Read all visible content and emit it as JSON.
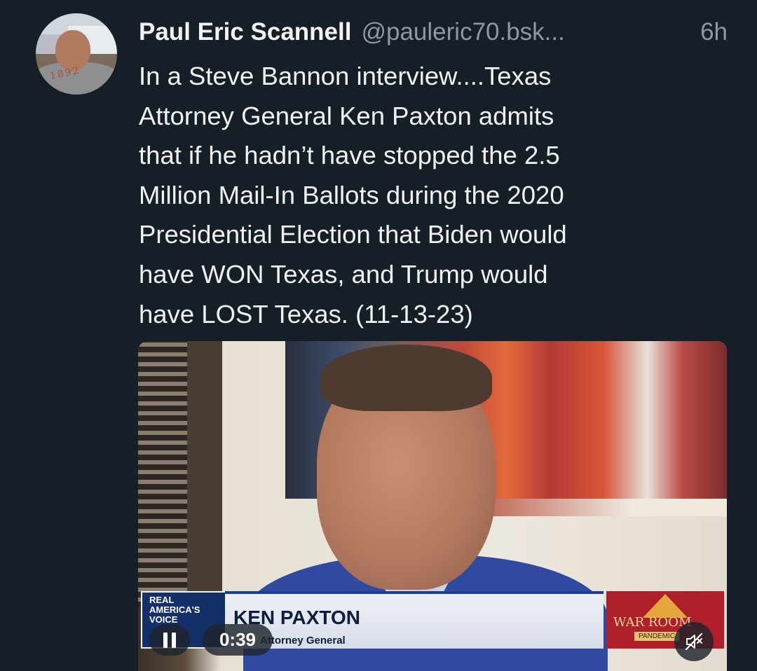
{
  "post": {
    "author_name": "Paul Eric Scannell",
    "author_handle": "@pauleric70.bsk...",
    "timestamp": "6h",
    "avatar_text": "1892",
    "body": "In a  Steve Bannon interview....Texas\nAttorney General Ken Paxton admits\nthat if he hadn’t  have stopped the 2.5\nMillion Mail-In Ballots during the 2020\nPresidential Election that Biden would\nhave WON Texas, and Trump  would\nhave LOST Texas. (11-13-23)"
  },
  "video": {
    "network_logo": "REAL AMERICA'S VOICE",
    "lower_third_name": "KEN PAXTON",
    "lower_third_title": "Attorney General",
    "show_logo": "WAR ROOM",
    "show_logo_sub": "PANDEMIC",
    "elapsed": "0:39",
    "play_state": "pause-icon",
    "mute_state": "muted-icon"
  },
  "colors": {
    "background": "#161e27",
    "text_primary": "#f1f3f5",
    "text_secondary": "#8d98a5"
  }
}
